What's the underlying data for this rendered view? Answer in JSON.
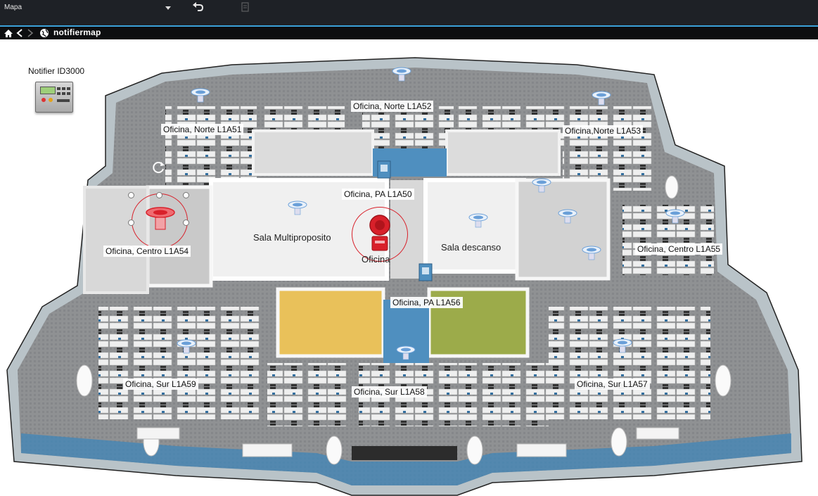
{
  "toolbar": {
    "title": "Mapa",
    "icons": [
      "chevron-down-icon",
      "undo-icon",
      "document-icon"
    ],
    "accent_color": "#3aa0d8"
  },
  "nav": {
    "title": "notifiermap",
    "icons": [
      "home-icon",
      "back-icon",
      "forward-icon",
      "globe-icon"
    ]
  },
  "map": {
    "panel_label": "Notifier ID3000",
    "zones": {
      "north_52": "Oficina, Norte L1A52",
      "north_51": "Oficina, Norte L1A51",
      "north_53": "Oficina,Norte L1A53",
      "pa_50": "Oficina, PA L1A50",
      "center_54": "Oficina, Centro L1A54",
      "center_55": "Oficina, Centro L1A55",
      "pa_56": "Oficina, PA L1A56",
      "south_59": "Oficina, Sur L1A59",
      "south_58": "Oficina, Sur L1A58",
      "south_57": "Oficina, Sur L1A57"
    },
    "rooms": {
      "multipurpose": "Sala Multiproposito",
      "rest": "Sala descanso",
      "alarm_caption": "Oficina"
    },
    "alarm_color": "#d8202a",
    "detector_color": "#6a9fd8"
  }
}
